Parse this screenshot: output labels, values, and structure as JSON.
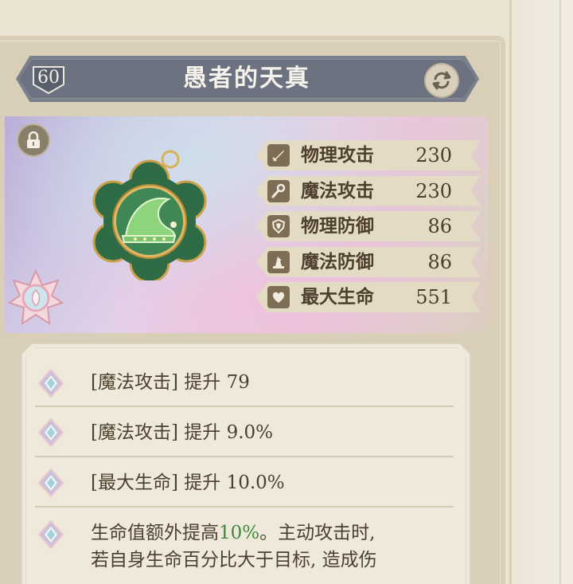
{
  "item": {
    "level": "60",
    "name": "愚者的天真"
  },
  "icons": {
    "swap": "swap-arrows-icon",
    "lock": "lock-icon",
    "emblem": "star-lotus-emblem-icon"
  },
  "stats": [
    {
      "icon": "sword-icon",
      "label": "物理攻击",
      "value": "230"
    },
    {
      "icon": "staff-icon",
      "label": "魔法攻击",
      "value": "230"
    },
    {
      "icon": "shield-icon",
      "label": "物理防御",
      "value": "86"
    },
    {
      "icon": "wizard-hat-icon",
      "label": "魔法防御",
      "value": "86"
    },
    {
      "icon": "heart-icon",
      "label": "最大生命",
      "value": "551"
    }
  ],
  "effects": [
    {
      "text": "[魔法攻击] 提升 79"
    },
    {
      "text": "[魔法攻击] 提升 9.0%"
    },
    {
      "text": "[最大生命] 提升 10.0%"
    },
    {
      "line1_before": "生命值额外提高",
      "line1_highlight": "10%",
      "line1_after": "。主动攻击时,",
      "line2": "若自身生命百分比大于目标, 造成伤"
    }
  ],
  "colors": {
    "highlight": "#3e8a3c",
    "title_bar": "#6d7280",
    "text": "#4d3f2d"
  }
}
